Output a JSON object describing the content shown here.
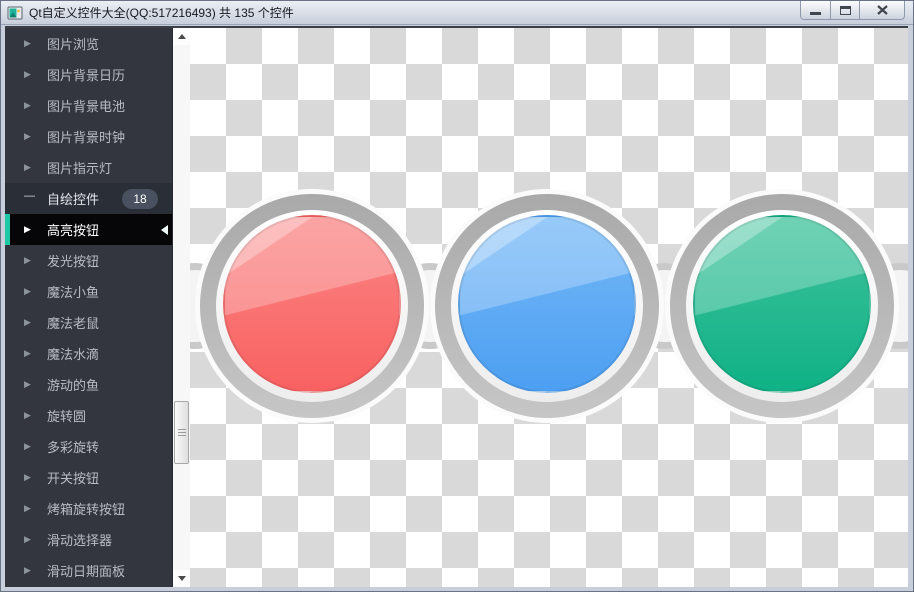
{
  "window": {
    "title": "Qt自定义控件大全(QQ:517216493) 共 135 个控件",
    "controls": {
      "minimize": "minimize-icon",
      "maximize": "maximize-icon",
      "close": "close-icon"
    }
  },
  "sidebar": {
    "accent_color": "#1ec8a5",
    "selected_bg": "#060608",
    "bg_color": "#33363f",
    "items": [
      {
        "label": "图片浏览",
        "arrow": "▶"
      },
      {
        "label": "图片背景日历",
        "arrow": "▶"
      },
      {
        "label": "图片背景电池",
        "arrow": "▶"
      },
      {
        "label": "图片背景时钟",
        "arrow": "▶"
      },
      {
        "label": "图片指示灯",
        "arrow": "▶"
      },
      {
        "label": "自绘控件",
        "arrow": "—",
        "badge": "18",
        "expanded": true
      },
      {
        "label": "高亮按钮",
        "arrow": "▶",
        "selected": true
      },
      {
        "label": "发光按钮",
        "arrow": "▶"
      },
      {
        "label": "魔法小鱼",
        "arrow": "▶"
      },
      {
        "label": "魔法老鼠",
        "arrow": "▶"
      },
      {
        "label": "魔法水滴",
        "arrow": "▶"
      },
      {
        "label": "游动的鱼",
        "arrow": "▶"
      },
      {
        "label": "旋转圆",
        "arrow": "▶"
      },
      {
        "label": "多彩旋转",
        "arrow": "▶"
      },
      {
        "label": "开关按钮",
        "arrow": "▶"
      },
      {
        "label": "烤箱旋转按钮",
        "arrow": "▶"
      },
      {
        "label": "滑动选择器",
        "arrow": "▶"
      },
      {
        "label": "滑动日期面板",
        "arrow": "▶"
      }
    ]
  },
  "main": {
    "widget_name": "高亮按钮",
    "checker_colors": [
      "#ffffff",
      "#d9d9d9"
    ],
    "buttons": [
      {
        "name": "red-highlight-button",
        "color": "#f96666"
      },
      {
        "name": "blue-highlight-button",
        "color": "#4d9ff2"
      },
      {
        "name": "green-highlight-button",
        "color": "#10b186"
      }
    ],
    "ring_color": "#b5b5b5"
  }
}
